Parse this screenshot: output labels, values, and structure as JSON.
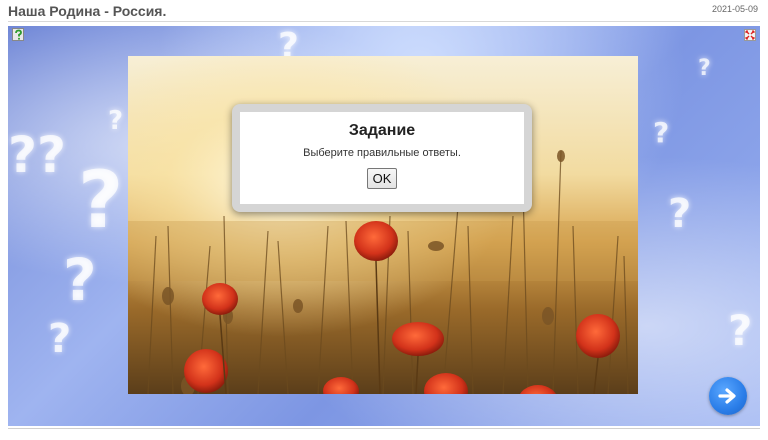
{
  "header": {
    "title": "Наша Родина - Россия.",
    "date": "2021-05-09"
  },
  "icons": {
    "help": "help-icon",
    "fullscreen": "fullscreen-icon",
    "next": "arrow-right-icon"
  },
  "picture": {
    "subject": "poppy-field-at-sunset"
  },
  "dialog": {
    "title": "Задание",
    "message": "Выберите правильные ответы.",
    "ok_label": "OK"
  },
  "colors": {
    "accent_blue": "#2a7de8",
    "background_blue": "#7d96e3"
  }
}
